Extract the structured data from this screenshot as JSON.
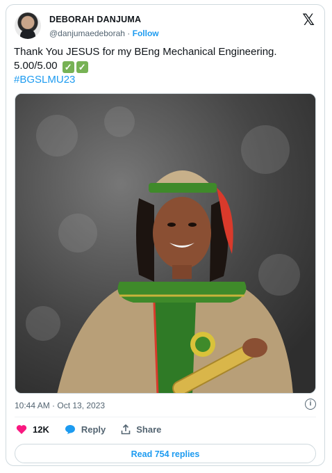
{
  "author": {
    "name": "DEBORAH DANJUMA",
    "handle": "@danjumaedeborah",
    "separator": " · ",
    "follow_label": "Follow"
  },
  "platform_logo": "𝕏",
  "tweet": {
    "line1": "Thank You JESUS for my BEng Mechanical Engineering.",
    "line2": "5.00/5.00",
    "check_glyph": "✓",
    "hashtag": "#BGSLMU23"
  },
  "timestamp": "10:44 AM · Oct 13, 2023",
  "info_glyph": "i",
  "actions": {
    "likes": "12K",
    "reply_label": "Reply",
    "share_label": "Share"
  },
  "read_replies_label": "Read 754 replies",
  "colors": {
    "accent": "#1d9bf0",
    "like": "#f91880",
    "check_green": "#77b255",
    "photo_backdrop": "#3d3d3d",
    "gown": "#b89f78",
    "stole_green": "#3f8a2a",
    "tassel_red": "#d93a2b"
  },
  "icons": [
    "x-logo-icon",
    "heart-icon",
    "reply-bubble-icon",
    "share-icon",
    "info-icon"
  ]
}
